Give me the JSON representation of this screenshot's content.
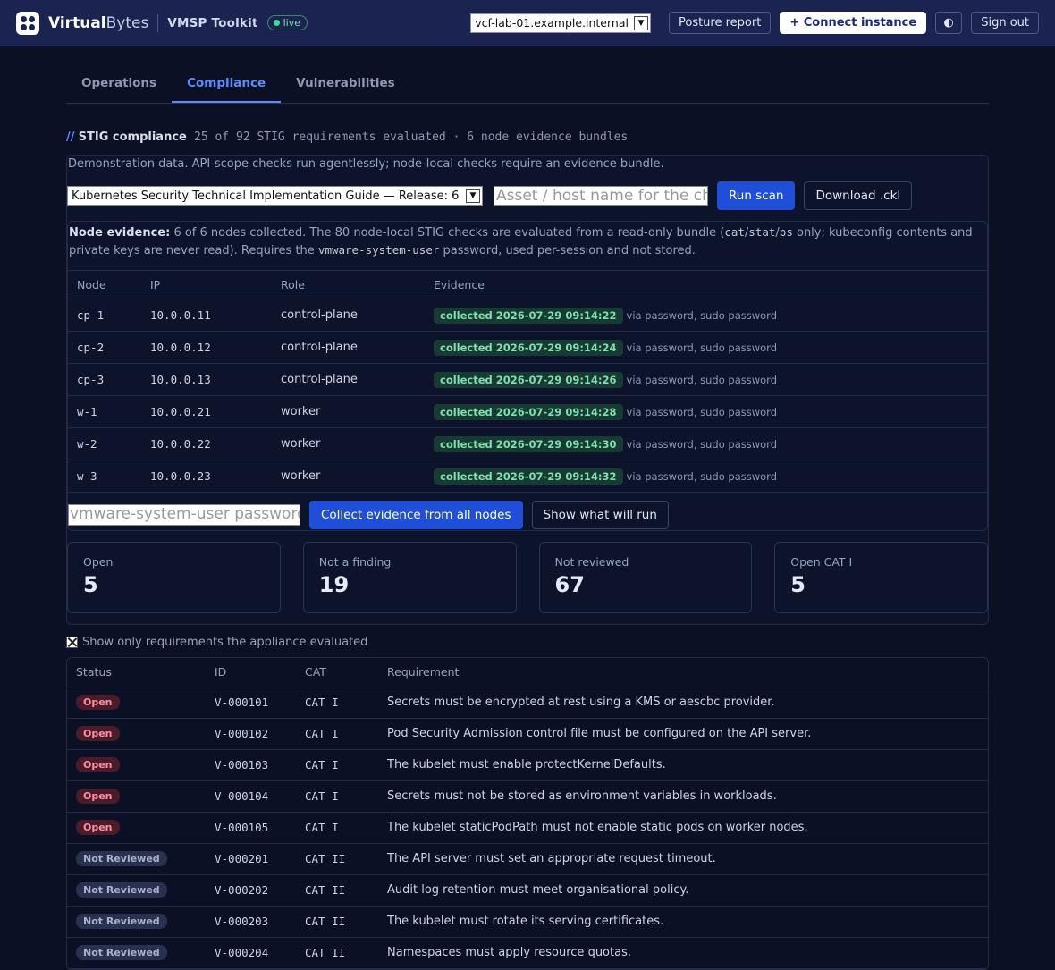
{
  "header": {
    "brand_bold": "Virtual",
    "brand_light": "Bytes",
    "product": "VMSP Toolkit",
    "live": "live",
    "instance": "vcf-lab-01.example.internal",
    "posture": "Posture report",
    "connect": "+ Connect instance",
    "theme_icon": "◐",
    "signout": "Sign out"
  },
  "tabs": [
    {
      "label": "Operations"
    },
    {
      "label": "Compliance"
    },
    {
      "label": "Vulnerabilities"
    }
  ],
  "section": {
    "slashes": "//",
    "title": "STIG compliance",
    "meta": "25 of 92 STIG requirements evaluated · 6 node evidence bundles"
  },
  "note": "Demonstration data. API-scope checks run agentlessly; node-local checks require an evidence bundle.",
  "controls": {
    "stig_select": "Kubernetes Security Technical Implementation Guide — Release: 6",
    "asset_placeholder": "Asset / host name for the ch",
    "run": "Run scan",
    "download": "Download .ckl"
  },
  "evidence": {
    "label": "Node evidence:",
    "text1": "6 of 6 nodes collected. The 80 node-local STIG checks are evaluated from a read-only bundle (",
    "code1": "cat",
    "slash1": "/",
    "code2": "stat",
    "slash2": "/",
    "code3": "ps",
    "text2": " only; kubeconfig contents and private keys are never read). Requires the ",
    "code4": "vmware-system-user",
    "text3": " password, used per-session and not stored.",
    "columns": [
      "Node",
      "IP",
      "Role",
      "Evidence"
    ],
    "nodes": [
      {
        "node": "cp-1",
        "ip": "10.0.0.11",
        "role": "control-plane",
        "badge": "collected 2026-07-29 09:14:22",
        "via": "via password, sudo password"
      },
      {
        "node": "cp-2",
        "ip": "10.0.0.12",
        "role": "control-plane",
        "badge": "collected 2026-07-29 09:14:24",
        "via": "via password, sudo password"
      },
      {
        "node": "cp-3",
        "ip": "10.0.0.13",
        "role": "control-plane",
        "badge": "collected 2026-07-29 09:14:26",
        "via": "via password, sudo password"
      },
      {
        "node": "w-1",
        "ip": "10.0.0.21",
        "role": "worker",
        "badge": "collected 2026-07-29 09:14:28",
        "via": "via password, sudo password"
      },
      {
        "node": "w-2",
        "ip": "10.0.0.22",
        "role": "worker",
        "badge": "collected 2026-07-29 09:14:30",
        "via": "via password, sudo password"
      },
      {
        "node": "w-3",
        "ip": "10.0.0.23",
        "role": "worker",
        "badge": "collected 2026-07-29 09:14:32",
        "via": "via password, sudo password"
      }
    ],
    "pw_placeholder": "vmware-system-user password",
    "collect": "Collect evidence from all nodes",
    "show": "Show what will run"
  },
  "stats": [
    {
      "label": "Open",
      "value": "5"
    },
    {
      "label": "Not a finding",
      "value": "19"
    },
    {
      "label": "Not reviewed",
      "value": "67"
    },
    {
      "label": "Open CAT I",
      "value": "5"
    }
  ],
  "filter_label": "Show only requirements the appliance evaluated",
  "requirements": {
    "columns": [
      "Status",
      "ID",
      "CAT",
      "Requirement"
    ],
    "rows": [
      {
        "status": "Open",
        "kind": "open",
        "id": "V-000101",
        "cat": "CAT I",
        "req": "Secrets must be encrypted at rest using a KMS or aescbc provider."
      },
      {
        "status": "Open",
        "kind": "open",
        "id": "V-000102",
        "cat": "CAT I",
        "req": "Pod Security Admission control file must be configured on the API server."
      },
      {
        "status": "Open",
        "kind": "open",
        "id": "V-000103",
        "cat": "CAT I",
        "req": "The kubelet must enable protectKernelDefaults."
      },
      {
        "status": "Open",
        "kind": "open",
        "id": "V-000104",
        "cat": "CAT I",
        "req": "Secrets must not be stored as environment variables in workloads."
      },
      {
        "status": "Open",
        "kind": "open",
        "id": "V-000105",
        "cat": "CAT I",
        "req": "The kubelet staticPodPath must not enable static pods on worker nodes."
      },
      {
        "status": "Not Reviewed",
        "kind": "nr",
        "id": "V-000201",
        "cat": "CAT II",
        "req": "The API server must set an appropriate request timeout."
      },
      {
        "status": "Not Reviewed",
        "kind": "nr",
        "id": "V-000202",
        "cat": "CAT II",
        "req": "Audit log retention must meet organisational policy."
      },
      {
        "status": "Not Reviewed",
        "kind": "nr",
        "id": "V-000203",
        "cat": "CAT II",
        "req": "The kubelet must rotate its serving certificates."
      },
      {
        "status": "Not Reviewed",
        "kind": "nr",
        "id": "V-000204",
        "cat": "CAT II",
        "req": "Namespaces must apply resource quotas."
      }
    ]
  },
  "colors": {
    "accent": "#5b8cff",
    "primary_button": "#1f4fd8",
    "open_badge": "#ff8fa0",
    "collected_badge": "#7fe0b0"
  }
}
